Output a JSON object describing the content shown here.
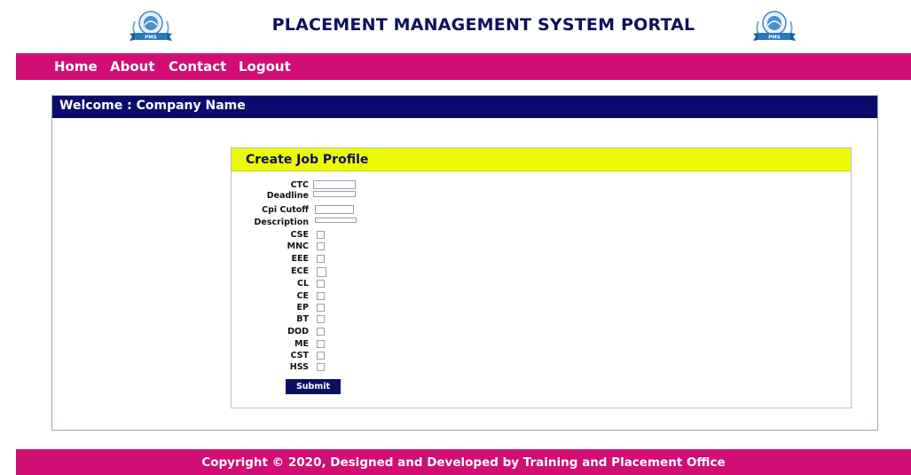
{
  "header": {
    "title": "PLACEMENT MANAGEMENT SYSTEM PORTAL",
    "logo_text": "PMS"
  },
  "nav": {
    "items": [
      {
        "label": "Home"
      },
      {
        "label": "About"
      },
      {
        "label": "Contact"
      },
      {
        "label": "Logout"
      }
    ]
  },
  "welcome": {
    "title": "Welcome : Company Name"
  },
  "form": {
    "title": "Create Job Profile",
    "text_fields": [
      {
        "label": "CTC",
        "value": ""
      },
      {
        "label": "Deadline",
        "value": ""
      },
      {
        "label": "Cpi Cutoff",
        "value": ""
      },
      {
        "label": "Description",
        "value": ""
      }
    ],
    "checkboxes": [
      {
        "label": "CSE"
      },
      {
        "label": "MNC"
      },
      {
        "label": "EEE"
      },
      {
        "label": "ECE"
      },
      {
        "label": "CL"
      },
      {
        "label": "CE"
      },
      {
        "label": "EP"
      },
      {
        "label": "BT"
      },
      {
        "label": "DOD"
      },
      {
        "label": "ME"
      },
      {
        "label": "CST"
      },
      {
        "label": "HSS"
      }
    ],
    "submit_label": "Submit"
  },
  "footer": {
    "text": "Copyright © 2020, Designed and Developed by Training and Placement Office"
  },
  "colors": {
    "brand_pink": "#d10e74",
    "navy": "#0b0b6e",
    "form_header": "#ecfb00",
    "title_text": "#0b1060"
  }
}
